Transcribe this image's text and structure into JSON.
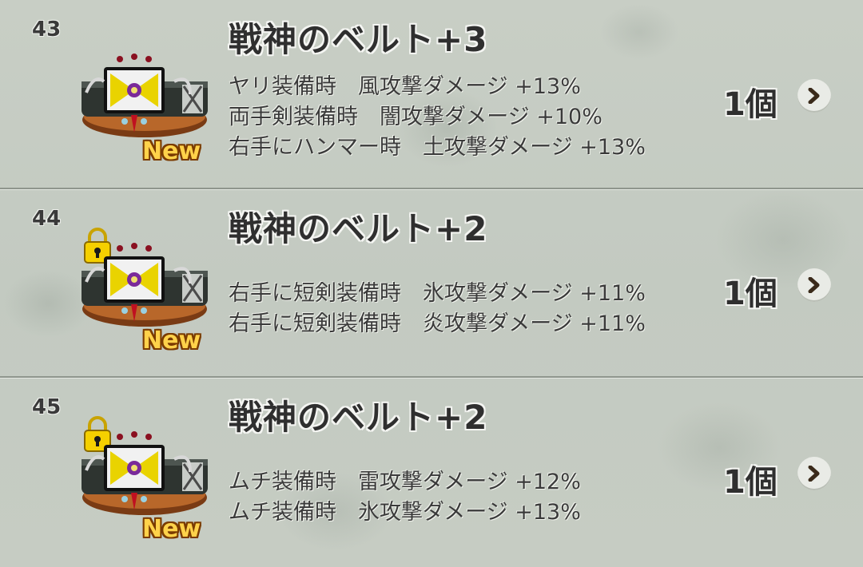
{
  "items": [
    {
      "number": "43",
      "name": "戦神のベルト+3",
      "locked": false,
      "new_label": "New",
      "effects": [
        "ヤリ装備時　風攻撃ダメージ +13%",
        "両手剣装備時　闇攻撃ダメージ +10%",
        "右手にハンマー時　土攻撃ダメージ +13%"
      ],
      "count": "1個"
    },
    {
      "number": "44",
      "name": "戦神のベルト+2",
      "locked": true,
      "new_label": "New",
      "effects": [
        "右手に短剣装備時　氷攻撃ダメージ +11%",
        "右手に短剣装備時　炎攻撃ダメージ +11%"
      ],
      "count": "1個"
    },
    {
      "number": "45",
      "name": "戦神のベルト+2",
      "locked": true,
      "new_label": "New",
      "effects": [
        "ムチ装備時　雷攻撃ダメージ +12%",
        "ムチ装備時　氷攻撃ダメージ +13%"
      ],
      "count": "1個"
    }
  ],
  "icons": {
    "item": "belt-icon",
    "lock": "lock-icon",
    "arrow": "chevron-right-icon"
  },
  "colors": {
    "new_text": "#ffd24a",
    "new_outline": "#7a3b00",
    "lock": "#f5d000"
  }
}
